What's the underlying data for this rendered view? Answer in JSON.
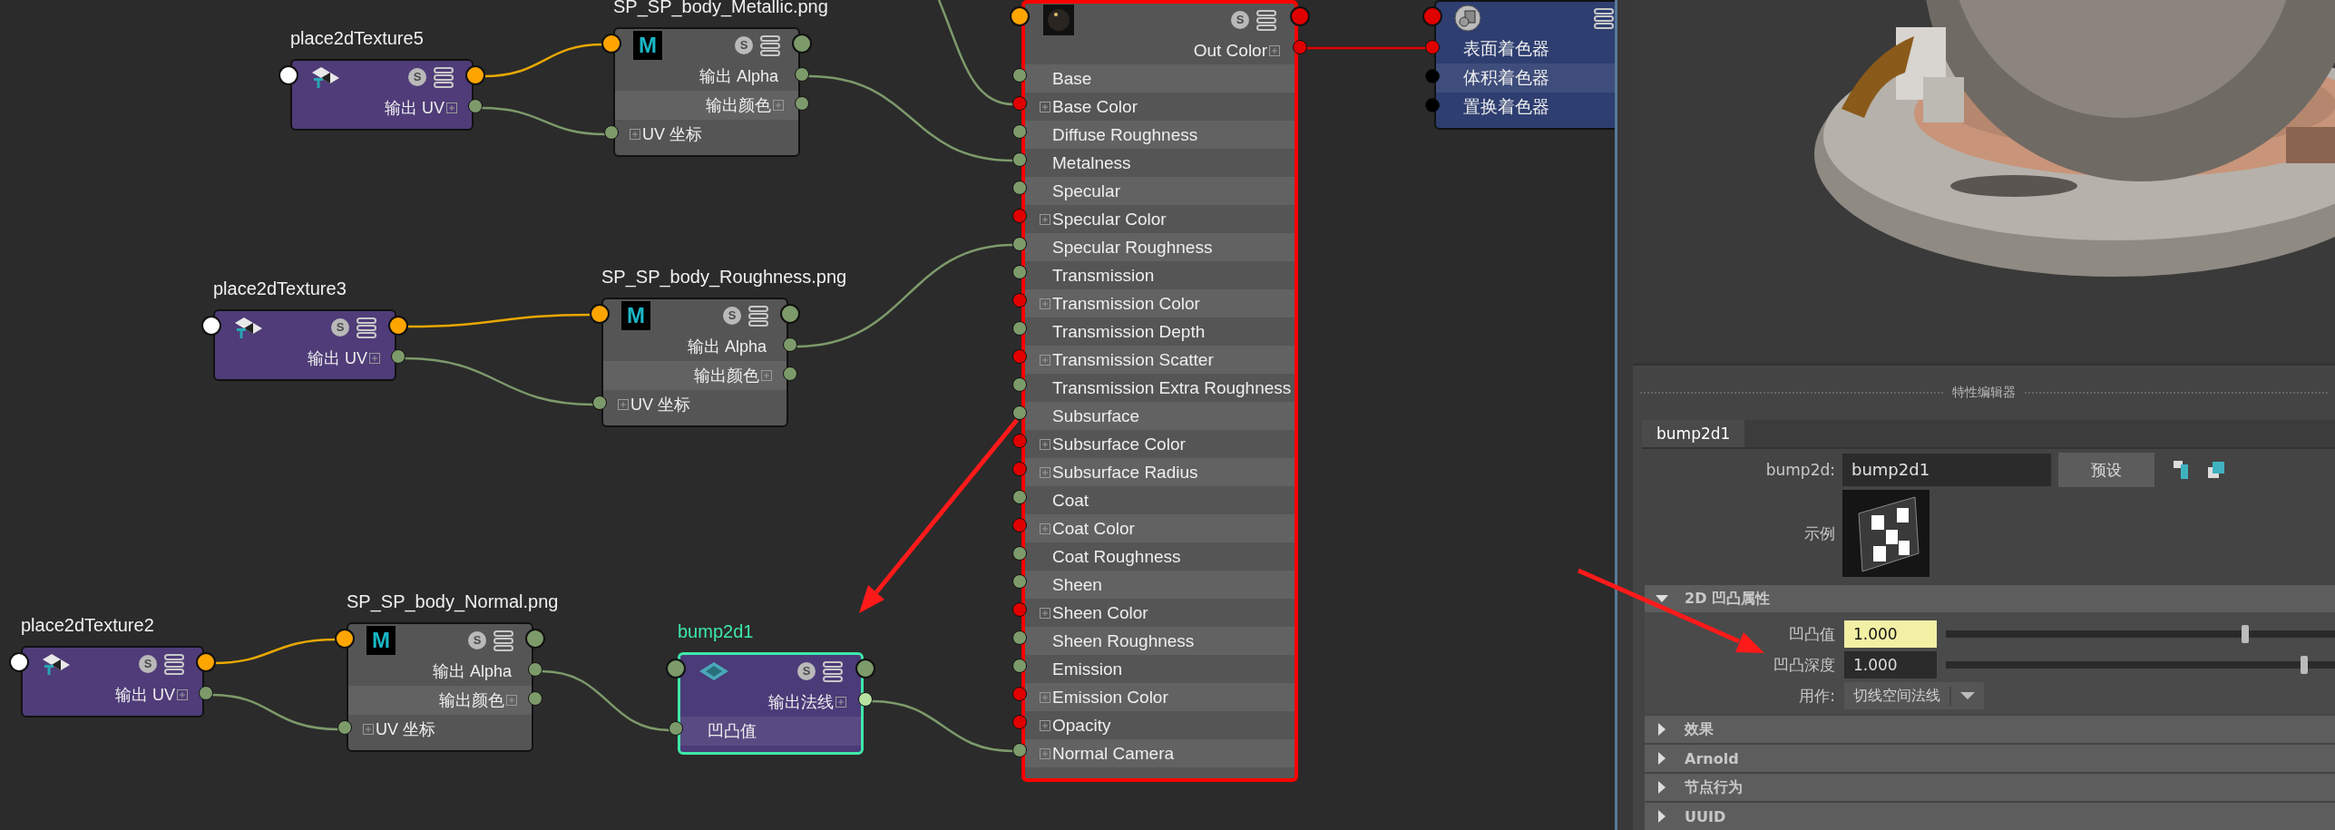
{
  "node_editor": {
    "nodes": [
      {
        "kind": "place2d",
        "title": "place2dTexture5",
        "badge": "S",
        "selected": false,
        "highlighted": false,
        "ports": [
          {
            "label": "输出 UV",
            "kind": "output",
            "expandable": true,
            "color": "#7d9a6b"
          }
        ]
      },
      {
        "kind": "file",
        "title": "SP_SP_body_Metallic.png",
        "logo": "M",
        "badge": "S",
        "selected": false,
        "highlighted": false,
        "ports": [
          {
            "label": "输出 Alpha",
            "kind": "output",
            "expandable": false,
            "color": "#7d9a6b"
          },
          {
            "label": "输出颜色",
            "kind": "output",
            "expandable": true,
            "color": "#7d9a6b"
          },
          {
            "label": "UV 坐标",
            "kind": "input",
            "expandable": true,
            "color": "#7d9a6b"
          }
        ]
      },
      {
        "kind": "place2d",
        "title": "place2dTexture3",
        "badge": "S",
        "selected": false,
        "highlighted": false,
        "ports": [
          {
            "label": "输出 UV",
            "kind": "output",
            "expandable": true,
            "color": "#7d9a6b"
          }
        ]
      },
      {
        "kind": "file",
        "title": "SP_SP_body_Roughness.png",
        "logo": "M",
        "badge": "S",
        "selected": false,
        "highlighted": false,
        "ports": [
          {
            "label": "输出 Alpha",
            "kind": "output",
            "expandable": false,
            "color": "#7d9a6b"
          },
          {
            "label": "输出颜色",
            "kind": "output",
            "expandable": true,
            "color": "#7d9a6b"
          },
          {
            "label": "UV 坐标",
            "kind": "input",
            "expandable": true,
            "color": "#7d9a6b"
          }
        ]
      },
      {
        "kind": "place2d",
        "title": "place2dTexture2",
        "badge": "S",
        "selected": false,
        "highlighted": false,
        "ports": [
          {
            "label": "输出 UV",
            "kind": "output",
            "expandable": true,
            "color": "#7d9a6b"
          }
        ]
      },
      {
        "kind": "file",
        "title": "SP_SP_body_Normal.png",
        "logo": "M",
        "badge": "S",
        "selected": false,
        "highlighted": false,
        "ports": [
          {
            "label": "输出 Alpha",
            "kind": "output",
            "expandable": false,
            "color": "#7d9a6b"
          },
          {
            "label": "输出颜色",
            "kind": "output",
            "expandable": true,
            "color": "#7d9a6b"
          },
          {
            "label": "UV 坐标",
            "kind": "input",
            "expandable": true,
            "color": "#7d9a6b"
          }
        ]
      },
      {
        "kind": "bump",
        "title": "bump2d1",
        "badge": "S",
        "selected": true,
        "highlighted": false,
        "ports": [
          {
            "label": "输出法线",
            "kind": "output",
            "expandable": true,
            "color": "#b8e0a0"
          },
          {
            "label": "凹凸值",
            "kind": "input",
            "expandable": false,
            "color": "#7d9a6b"
          }
        ]
      },
      {
        "kind": "shader",
        "badge": "S",
        "selected": false,
        "highlighted": true,
        "ports": [
          {
            "label": "Out Color",
            "kind": "output",
            "expandable": true,
            "color": "#e00000"
          },
          {
            "label": "Base",
            "kind": "input",
            "expandable": false,
            "color": "#7d9a6b"
          },
          {
            "label": "Base Color",
            "kind": "input",
            "expandable": true,
            "color": "#e00000"
          },
          {
            "label": "Diffuse Roughness",
            "kind": "input",
            "expandable": false,
            "color": "#7d9a6b"
          },
          {
            "label": "Metalness",
            "kind": "input",
            "expandable": false,
            "color": "#7d9a6b"
          },
          {
            "label": "Specular",
            "kind": "input",
            "expandable": false,
            "color": "#7d9a6b"
          },
          {
            "label": "Specular Color",
            "kind": "input",
            "expandable": true,
            "color": "#e00000"
          },
          {
            "label": "Specular Roughness",
            "kind": "input",
            "expandable": false,
            "color": "#7d9a6b"
          },
          {
            "label": "Transmission",
            "kind": "input",
            "expandable": false,
            "color": "#7d9a6b"
          },
          {
            "label": "Transmission Color",
            "kind": "input",
            "expandable": true,
            "color": "#e00000"
          },
          {
            "label": "Transmission Depth",
            "kind": "input",
            "expandable": false,
            "color": "#7d9a6b"
          },
          {
            "label": "Transmission Scatter",
            "kind": "input",
            "expandable": true,
            "color": "#e00000"
          },
          {
            "label": "Transmission Extra Roughness",
            "kind": "input",
            "expandable": false,
            "color": "#7d9a6b"
          },
          {
            "label": "Subsurface",
            "kind": "input",
            "expandable": false,
            "color": "#7d9a6b"
          },
          {
            "label": "Subsurface Color",
            "kind": "input",
            "expandable": true,
            "color": "#e00000"
          },
          {
            "label": "Subsurface Radius",
            "kind": "input",
            "expandable": true,
            "color": "#e00000"
          },
          {
            "label": "Coat",
            "kind": "input",
            "expandable": false,
            "color": "#7d9a6b"
          },
          {
            "label": "Coat Color",
            "kind": "input",
            "expandable": true,
            "color": "#e00000"
          },
          {
            "label": "Coat Roughness",
            "kind": "input",
            "expandable": false,
            "color": "#7d9a6b"
          },
          {
            "label": "Sheen",
            "kind": "input",
            "expandable": false,
            "color": "#7d9a6b"
          },
          {
            "label": "Sheen Color",
            "kind": "input",
            "expandable": true,
            "color": "#e00000"
          },
          {
            "label": "Sheen Roughness",
            "kind": "input",
            "expandable": false,
            "color": "#7d9a6b"
          },
          {
            "label": "Emission",
            "kind": "input",
            "expandable": false,
            "color": "#7d9a6b"
          },
          {
            "label": "Emission Color",
            "kind": "input",
            "expandable": true,
            "color": "#e00000"
          },
          {
            "label": "Opacity",
            "kind": "input",
            "expandable": true,
            "color": "#e00000"
          },
          {
            "label": "Normal Camera",
            "kind": "input",
            "expandable": true,
            "color": "#7d9a6b"
          }
        ]
      },
      {
        "kind": "shading_group",
        "selected": false,
        "highlighted": false,
        "ports": [
          {
            "label": "表面着色器",
            "kind": "input",
            "expandable": false,
            "color": "#e00000"
          },
          {
            "label": "体积着色器",
            "kind": "input",
            "expandable": false,
            "color": "#000000"
          },
          {
            "label": "置换着色器",
            "kind": "input",
            "expandable": false,
            "color": "#000000"
          }
        ]
      }
    ]
  },
  "attribute_editor": {
    "title": "特性编辑器",
    "tabs": [
      {
        "label": "bump2d1",
        "selected": true
      }
    ],
    "type_label": "bump2d:",
    "name_value": "bump2d1",
    "preset_button": "预设",
    "sample_label": "示例",
    "sections": [
      {
        "title": "2D 凹凸属性",
        "expanded": true,
        "fields": [
          {
            "kind": "slider",
            "label": "凹凸值",
            "value": "1.000",
            "highlighted": true,
            "level": 0.77
          },
          {
            "kind": "slider",
            "label": "凹凸深度",
            "value": "1.000",
            "highlighted": false,
            "level": 0.92
          },
          {
            "kind": "dropdown",
            "label": "用作:",
            "value": "切线空间法线"
          }
        ]
      },
      {
        "title": "效果",
        "expanded": false
      },
      {
        "title": "Arnold",
        "expanded": false
      },
      {
        "title": "节点行为",
        "expanded": false
      },
      {
        "title": "UUID",
        "expanded": false
      }
    ]
  }
}
